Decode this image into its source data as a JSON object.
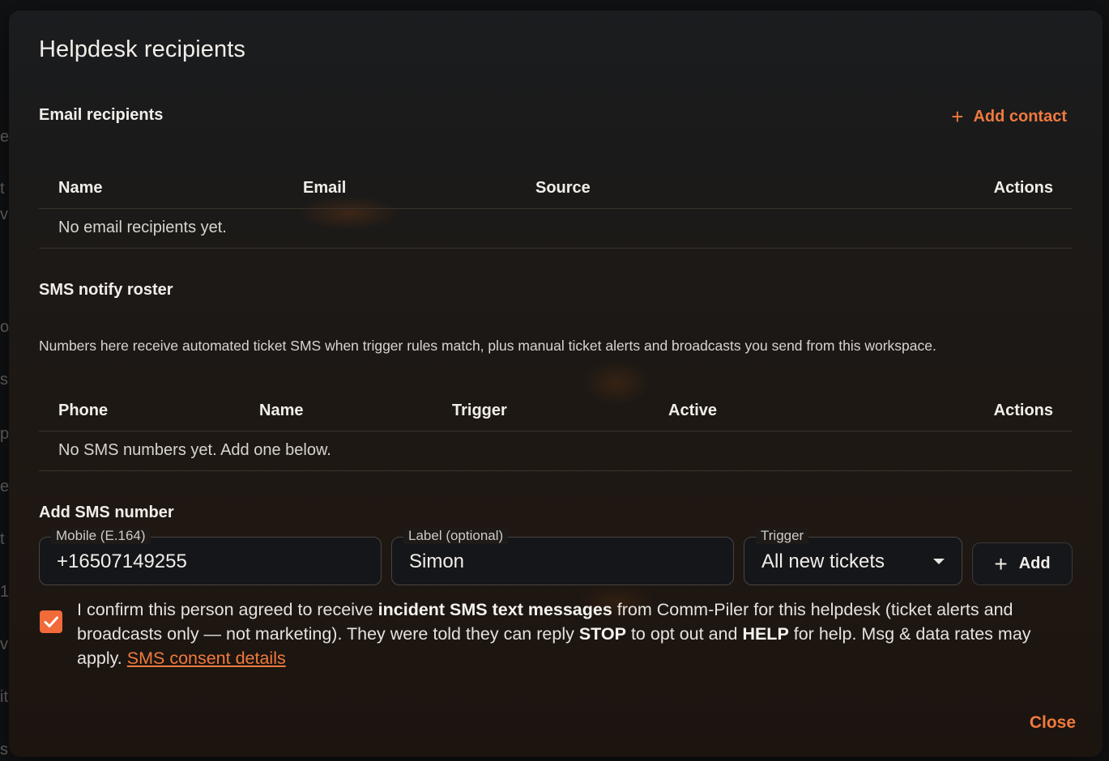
{
  "dialog": {
    "title": "Helpdesk recipients",
    "close_label": "Close"
  },
  "email": {
    "section_title": "Email recipients",
    "add_contact_label": "Add contact",
    "columns": [
      "Name",
      "Email",
      "Source",
      "Actions"
    ],
    "empty_text": "No email recipients yet."
  },
  "sms": {
    "section_title": "SMS notify roster",
    "description": "Numbers here receive automated ticket SMS when trigger rules match, plus manual ticket alerts and broadcasts you send from this workspace.",
    "columns": [
      "Phone",
      "Name",
      "Trigger",
      "Active",
      "Actions"
    ],
    "empty_text": "No SMS numbers yet. Add one below."
  },
  "add_form": {
    "section_title": "Add SMS number",
    "mobile_label": "Mobile (E.164)",
    "mobile_value": "+16507149255",
    "label_label": "Label (optional)",
    "label_value": "Simon",
    "trigger_label": "Trigger",
    "trigger_value": "All new tickets",
    "add_label": "Add",
    "consent_checked": true,
    "consent": {
      "t1": "I confirm this person agreed to receive ",
      "b1": "incident SMS text messages",
      "t2": " from Comm-Piler for this helpdesk (ticket alerts and broadcasts only — not marketing). They were told they can reply ",
      "b2": "STOP",
      "t3": " to opt out and ",
      "b3": "HELP",
      "t4": " for help. Msg & data rates may apply. ",
      "link": "SMS consent details"
    }
  },
  "colors": {
    "accent": "#f07a3e",
    "checkbox": "#f06a3a"
  }
}
